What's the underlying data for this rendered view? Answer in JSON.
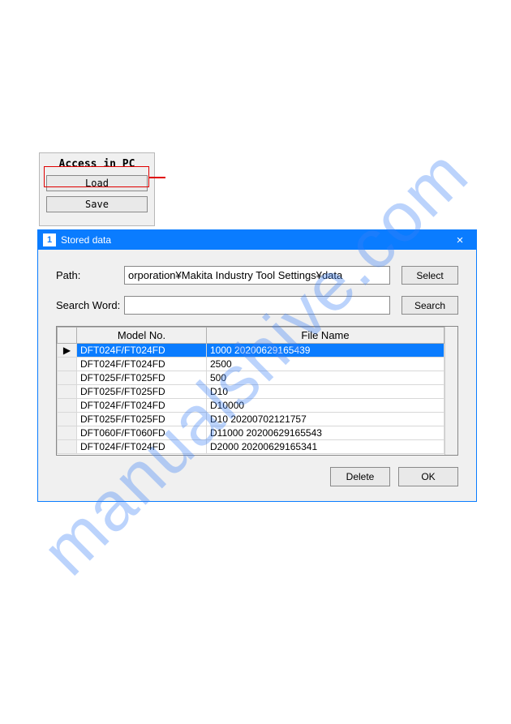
{
  "watermark": "manualshive.com",
  "access_panel": {
    "title": "Access in PC",
    "load_label": "Load",
    "save_label": "Save"
  },
  "dialog": {
    "title": "Stored data",
    "titlebar_icon_text": "1",
    "close_glyph": "×",
    "path_label": "Path:",
    "path_value": "orporation¥Makita Industry Tool Settings¥data",
    "select_label": "Select",
    "search_label": "Search Word:",
    "search_value": "",
    "search_btn_label": "Search",
    "columns": {
      "model": "Model No.",
      "file": "File Name"
    },
    "rows": [
      {
        "marker": "▶",
        "model": "DFT024F/FT024FD",
        "file": "1000 20200629165439",
        "selected": true
      },
      {
        "marker": "",
        "model": "DFT024F/FT024FD",
        "file": "2500",
        "selected": false
      },
      {
        "marker": "",
        "model": "DFT025F/FT025FD",
        "file": "500",
        "selected": false
      },
      {
        "marker": "",
        "model": "DFT025F/FT025FD",
        "file": "D10",
        "selected": false
      },
      {
        "marker": "",
        "model": "DFT024F/FT024FD",
        "file": "D10000",
        "selected": false
      },
      {
        "marker": "",
        "model": "DFT025F/FT025FD",
        "file": "D10 20200702121757",
        "selected": false
      },
      {
        "marker": "",
        "model": "DFT060F/FT060FD",
        "file": "D11000 20200629165543",
        "selected": false
      },
      {
        "marker": "",
        "model": "DFT024F/FT024FD",
        "file": "D2000 20200629165341",
        "selected": false
      }
    ],
    "delete_label": "Delete",
    "ok_label": "OK"
  }
}
